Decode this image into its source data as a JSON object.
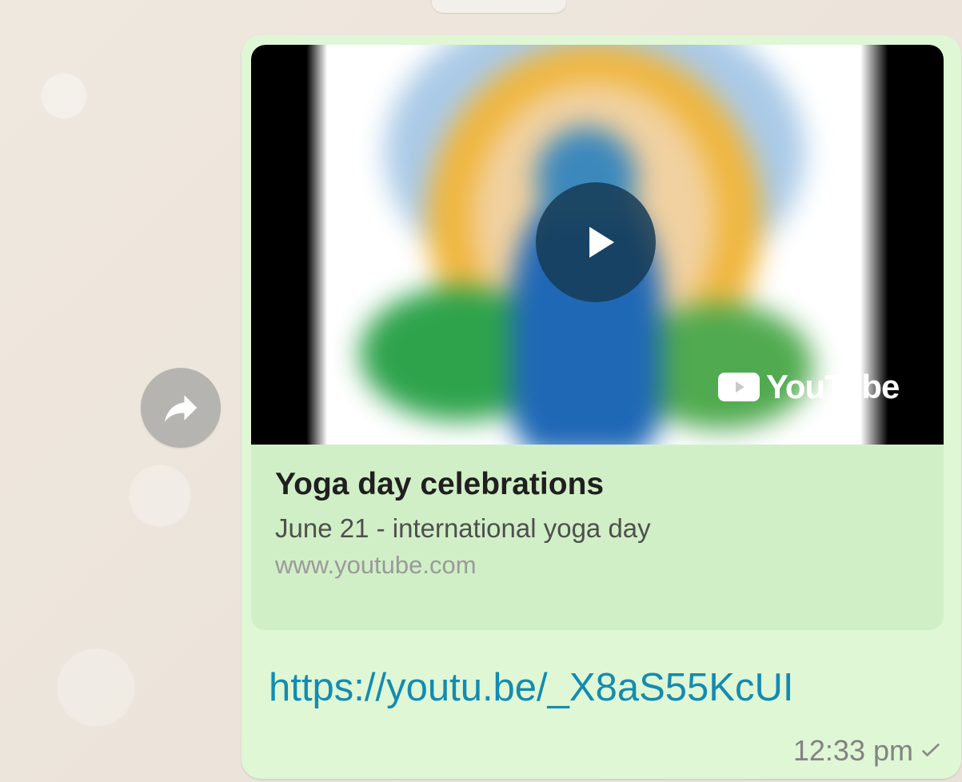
{
  "message": {
    "preview": {
      "title": "Yoga day celebrations",
      "description": "June 21 - international yoga day",
      "domain": "www.youtube.com",
      "brand": "YouTube"
    },
    "link_text": "https://youtu.be/_X8aS55KcUI",
    "time": "12:33 pm"
  },
  "icons": {
    "forward": "forward-icon",
    "play": "play-icon",
    "sent_status": "check-icon"
  },
  "colors": {
    "bubble_background": "#dff7d4",
    "preview_background": "#d1efc6",
    "link": "#148bb1",
    "timestamp": "#838383",
    "forward_button": "#b5b4b1"
  }
}
